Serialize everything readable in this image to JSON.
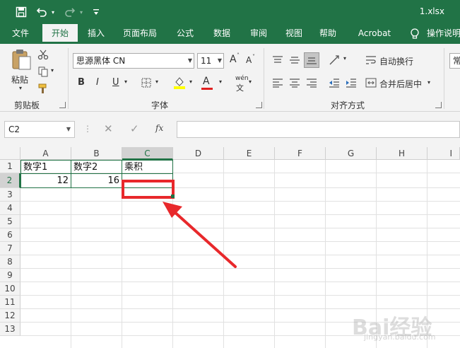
{
  "titlebar": {
    "filename": "1.xlsx",
    "qa_dropdown_label": "⊤"
  },
  "tabs": [
    "文件",
    "开始",
    "插入",
    "页面布局",
    "公式",
    "数据",
    "审阅",
    "视图",
    "帮助",
    "Acrobat",
    "操作说明搜索"
  ],
  "active_tab": "开始",
  "ribbon": {
    "clipboard": {
      "title": "剪贴板",
      "paste_label": "粘贴"
    },
    "font": {
      "title": "字体",
      "font_name": "思源黑体 CN",
      "font_size": "11",
      "bold": "B",
      "italic": "I",
      "underline": "U",
      "grow": "A",
      "shrink": "A",
      "color_a": "A",
      "phonetic": "wén"
    },
    "alignment": {
      "title": "对齐方式",
      "wrap_text": "自动换行",
      "merge_center": "合并后居中"
    },
    "number": {
      "format_partial": "常"
    }
  },
  "formula_bar": {
    "name_box": "C2",
    "fx_label": "fx",
    "formula": ""
  },
  "sheet": {
    "columns": [
      "A",
      "B",
      "C",
      "D",
      "E",
      "F",
      "G",
      "H",
      "I"
    ],
    "rows": [
      "1",
      "2",
      "3",
      "4",
      "5",
      "6",
      "7",
      "8",
      "9",
      "10",
      "11",
      "12",
      "13"
    ],
    "selected_cell": "C2",
    "cells": {
      "A1": "数字1",
      "B1": "数字2",
      "C1": "乘积",
      "A2": "12",
      "B2": "16"
    }
  },
  "watermark": {
    "main": "Bai经验",
    "sub": "jingyan.baidu.com"
  },
  "colors": {
    "excel_green": "#217346",
    "highlight_red": "#e8282b",
    "font_color_red": "#e02020",
    "highlight_yellow": "#ffff00"
  }
}
